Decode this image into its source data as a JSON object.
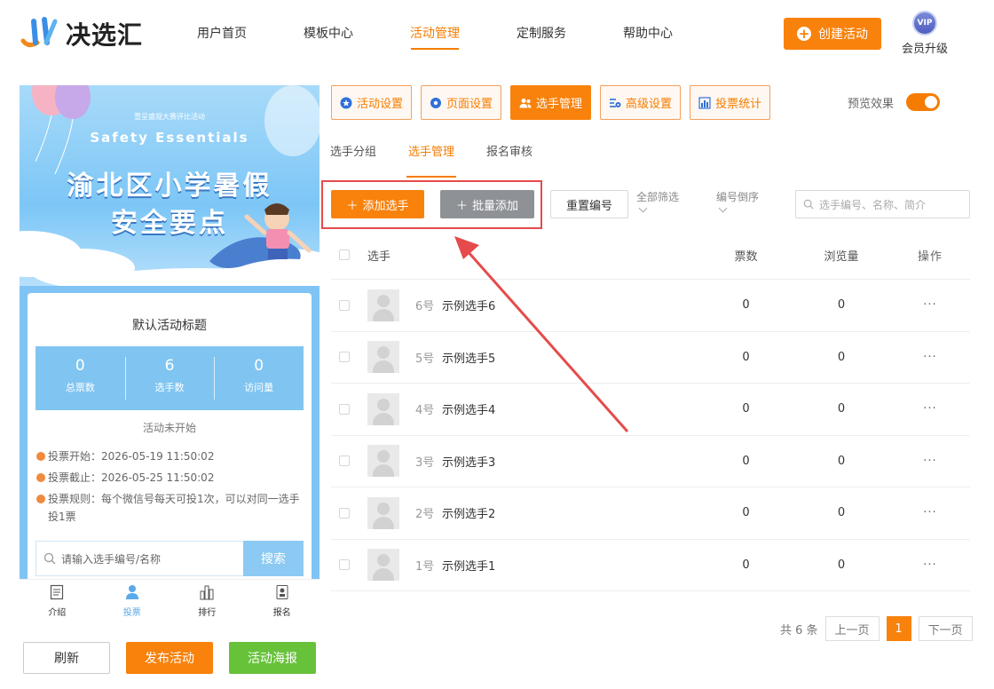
{
  "header": {
    "logo_text": "决选汇",
    "nav": [
      "用户首页",
      "模板中心",
      "活动管理",
      "定制服务",
      "帮助中心"
    ],
    "nav_active_index": 2,
    "create_button": "创建活动",
    "vip_badge": "VIP",
    "vip_label": "会员升级"
  },
  "preview": {
    "banner_small": "壹呈盛观大赛评比活动",
    "banner_en": "Safety  Essentials",
    "banner_title_line1": "渝北区小学暑假",
    "banner_title_line2": "安全要点",
    "card_title": "默认活动标题",
    "stats": [
      {
        "value": "0",
        "label": "总票数"
      },
      {
        "value": "6",
        "label": "选手数"
      },
      {
        "value": "0",
        "label": "访问量"
      }
    ],
    "status": "活动未开始",
    "vote_start": "投票开始：2026-05-19 11:50:02",
    "vote_end": "投票截止：2026-05-25 11:50:02",
    "vote_rule": "投票规则：每个微信号每天可投1次，可以对同一选手投1票",
    "search_placeholder": "请输入选手编号/名称",
    "search_button": "搜索",
    "bottom_nav": [
      "介绍",
      "投票",
      "排行",
      "报名"
    ],
    "bottom_nav_active_index": 1
  },
  "left_actions": {
    "refresh": "刷新",
    "publish": "发布活动",
    "poster": "活动海报"
  },
  "toolbar": {
    "buttons": [
      "活动设置",
      "页面设置",
      "选手管理",
      "高级设置",
      "投票统计"
    ],
    "active_index": 2,
    "preview_label": "预览效果",
    "preview_on": true
  },
  "subtabs": {
    "items": [
      "选手分组",
      "选手管理",
      "报名审核"
    ],
    "active_index": 1
  },
  "actions": {
    "add": "添加选手",
    "batch_add": "批量添加",
    "reset_numbers": "重置编号",
    "filter_all": "全部筛选",
    "sort_desc": "编号倒序",
    "search_placeholder": "选手编号、名称、简介"
  },
  "table": {
    "headers": {
      "player": "选手",
      "votes": "票数",
      "views": "浏览量",
      "ops": "操作"
    },
    "rows": [
      {
        "num": "6号",
        "name": "示例选手6",
        "votes": "0",
        "views": "0",
        "ops": "···"
      },
      {
        "num": "5号",
        "name": "示例选手5",
        "votes": "0",
        "views": "0",
        "ops": "···"
      },
      {
        "num": "4号",
        "name": "示例选手4",
        "votes": "0",
        "views": "0",
        "ops": "···"
      },
      {
        "num": "3号",
        "name": "示例选手3",
        "votes": "0",
        "views": "0",
        "ops": "···"
      },
      {
        "num": "2号",
        "name": "示例选手2",
        "votes": "0",
        "views": "0",
        "ops": "···"
      },
      {
        "num": "1号",
        "name": "示例选手1",
        "votes": "0",
        "views": "0",
        "ops": "···"
      }
    ]
  },
  "pagination": {
    "total": "共 6 条",
    "prev": "上一页",
    "current": "1",
    "next": "下一页"
  },
  "colors": {
    "accent": "#f8820c",
    "highlight_frame": "#e54b4b",
    "poster_green": "#67c23a"
  }
}
